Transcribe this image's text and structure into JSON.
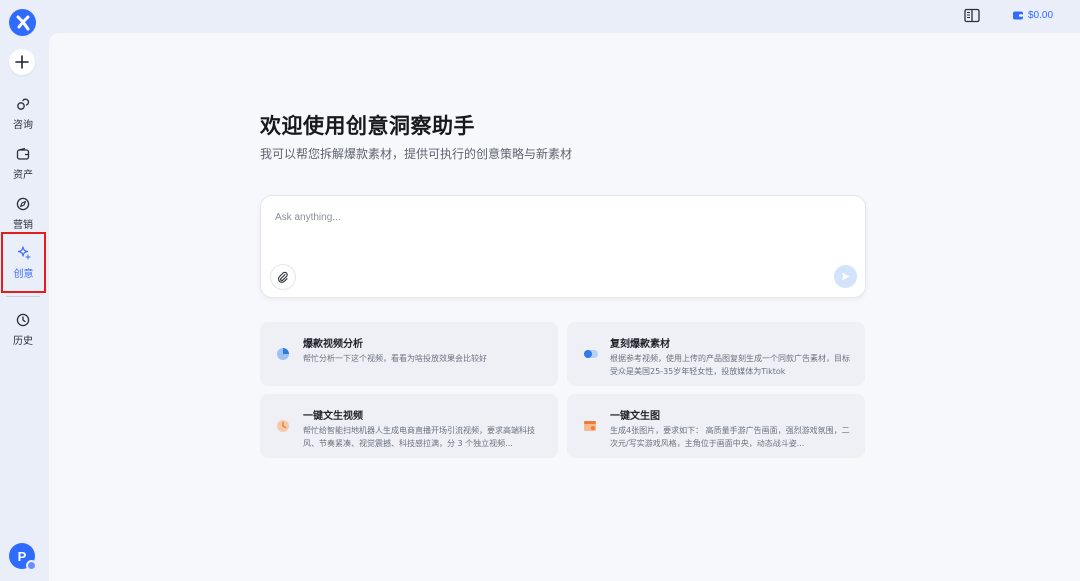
{
  "sidebar": {
    "items": [
      {
        "label": "咨询",
        "icon": "chat-link-icon"
      },
      {
        "label": "资产",
        "icon": "wallet-icon"
      },
      {
        "label": "营销",
        "icon": "compass-icon"
      },
      {
        "label": "创意",
        "icon": "sparkle-icon",
        "active": true
      },
      {
        "label": "历史",
        "icon": "clock-icon"
      }
    ],
    "avatar_letter": "P"
  },
  "topbar": {
    "balance": "$0.00"
  },
  "main": {
    "title": "欢迎使用创意洞察助手",
    "subtitle": "我可以帮您拆解爆款素材，提供可执行的创意策略与新素材",
    "chat": {
      "placeholder": "Ask anything..."
    },
    "cards": [
      {
        "title": "爆款视频分析",
        "desc": "帮忙分析一下这个视频，看看为啥投放效果会比较好",
        "icon": "pie-chart-icon"
      },
      {
        "title": "复刻爆款素材",
        "desc": "根据参考视频，使用上传的产品图复刻生成一个同款广告素材，目标受众是美国25-35岁年轻女性，投放媒体为Tiktok",
        "icon": "toggle-icon"
      },
      {
        "title": "一键文生视频",
        "desc": "帮忙给智能扫地机器人生成电商直播开场引流视频，要求高端科技风、节奏紧凑、视觉震撼、科技感拉满，分 3 个独立视频...",
        "icon": "timer-icon"
      },
      {
        "title": "一键文生图",
        "desc": "生成4张图片，要求如下： 高质量手游广告画面，强烈游戏氛围，二次元/写实游戏风格，主角位于画面中央，动态战斗姿...",
        "icon": "image-card-icon"
      }
    ]
  },
  "colors": {
    "accent": "#2f6bff",
    "highlight": "#e11d1d"
  }
}
